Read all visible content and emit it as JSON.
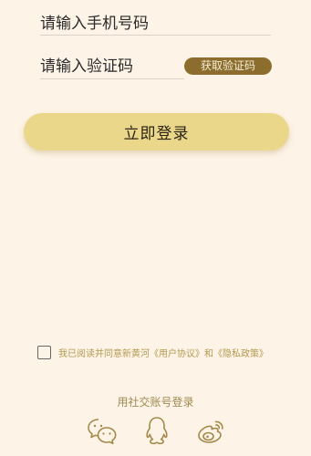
{
  "form": {
    "phone_placeholder": "请输入手机号码",
    "code_placeholder": "请输入验证码",
    "get_code_label": "获取验证码",
    "login_label": "立即登录"
  },
  "agreement": {
    "checked": false,
    "text": "我已阅读并同意新黄河《用户协议》和《隐私政策》"
  },
  "social": {
    "title": "用社交账号登录",
    "icons": [
      "wechat-icon",
      "qq-icon",
      "weibo-icon"
    ]
  },
  "colors": {
    "background": "#fdf3e6",
    "login_button": "#ead78a",
    "code_button": "#8c6d2d",
    "accent_text": "#b39a52"
  }
}
